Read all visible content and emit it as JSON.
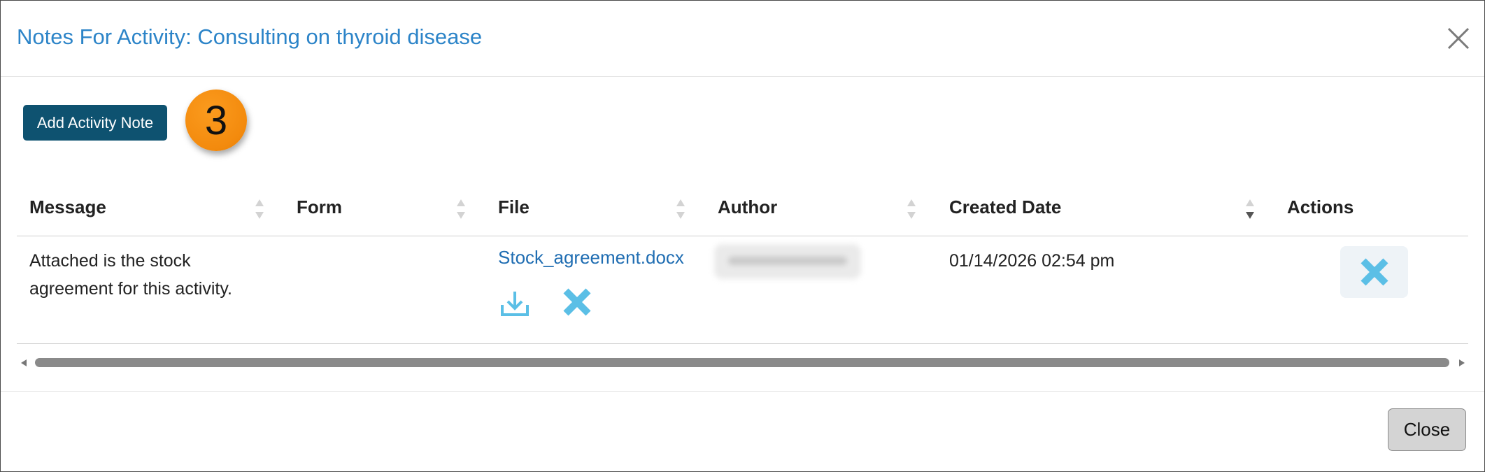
{
  "modal": {
    "title": "Notes For Activity: Consulting on thyroid disease",
    "close_icon": "close-icon"
  },
  "toolbar": {
    "add_note_label": "Add Activity Note",
    "step_number": "3"
  },
  "table": {
    "columns": [
      {
        "label": "Message",
        "sortable": true,
        "sorted": null
      },
      {
        "label": "Form",
        "sortable": true,
        "sorted": null
      },
      {
        "label": "File",
        "sortable": true,
        "sorted": null
      },
      {
        "label": "Author",
        "sortable": true,
        "sorted": null
      },
      {
        "label": "Created Date",
        "sortable": true,
        "sorted": "descending"
      },
      {
        "label": "Actions",
        "sortable": false,
        "sorted": null
      }
    ],
    "rows": [
      {
        "message_line1": "Attached is the stock",
        "message_line2": "agreement for this activity.",
        "form": "",
        "file_name": "Stock_agreement.docx",
        "file_icons": [
          "download-icon",
          "delete-icon"
        ],
        "author_redacted": true,
        "created_date": "01/14/2026 02:54 pm",
        "action_icon": "delete-icon"
      }
    ]
  },
  "footer": {
    "close_label": "Close"
  },
  "colors": {
    "title": "#2c84c8",
    "primary_button": "#0e5270",
    "step_badge": "#f38a0d",
    "link": "#1f6db2",
    "icon_blue": "#5bbfe6"
  }
}
